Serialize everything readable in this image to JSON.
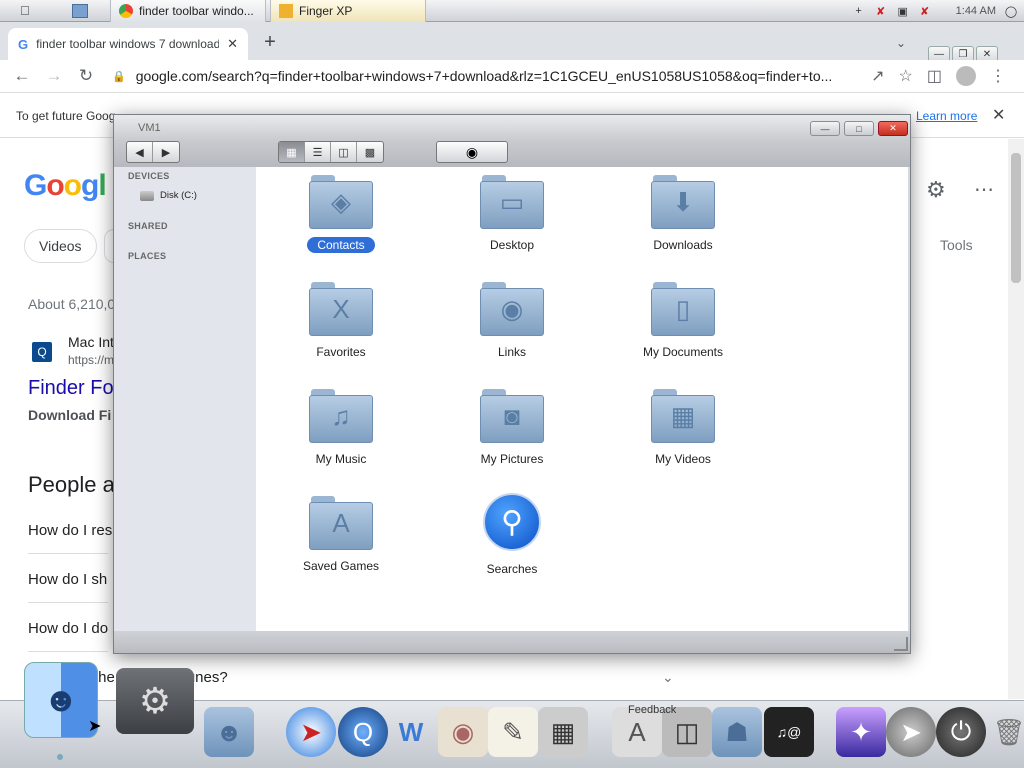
{
  "taskbar": {
    "tasks": [
      {
        "label": "finder toolbar windo..."
      },
      {
        "label": "Finger XP"
      }
    ],
    "clock": "1:44 AM"
  },
  "browser": {
    "tab_title": "finder toolbar windows 7 download",
    "url": "google.com/search?q=finder+toolbar+windows+7+download&rlz=1C1GCEU_enUS1058US1058&oq=finder+to...",
    "info_text": "To get future Goog",
    "learn_more": "Learn more"
  },
  "google": {
    "chips": [
      "Videos"
    ],
    "tools": "Tools",
    "about": "About 6,210,0",
    "result": {
      "site": "Mac Int",
      "url": "https://m",
      "title": "Finder Fo",
      "snippet": "Download Fi"
    },
    "people_also_ask": "People a",
    "questions": [
      "How do I res",
      "How do I sh",
      "How do I do"
    ],
    "question_last": "the ndow in iTunes?"
  },
  "finder": {
    "title": "VM1",
    "sidebar": {
      "devices": "DEVICES",
      "disk": "Disk (C:)",
      "shared": "SHARED",
      "places": "PLACES"
    },
    "items": [
      {
        "label": "Contacts",
        "glyph": "◈",
        "selected": true
      },
      {
        "label": "Desktop",
        "glyph": "▭"
      },
      {
        "label": "Downloads",
        "glyph": "⬇"
      },
      {
        "label": "Favorites",
        "glyph": "X"
      },
      {
        "label": "Links",
        "glyph": "◉"
      },
      {
        "label": "My Documents",
        "glyph": "▯"
      },
      {
        "label": "My Music",
        "glyph": "♫"
      },
      {
        "label": "My Pictures",
        "glyph": "◙"
      },
      {
        "label": "My Videos",
        "glyph": "▦"
      },
      {
        "label": "Saved Games",
        "glyph": "A"
      },
      {
        "label": "Searches",
        "glyph": "🔍"
      }
    ]
  },
  "dock": {
    "label": "Feedback"
  }
}
